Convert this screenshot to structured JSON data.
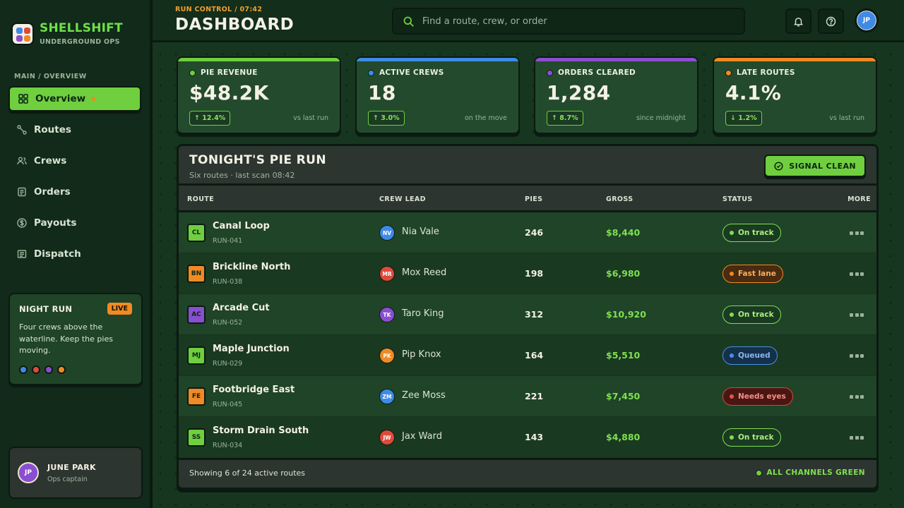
{
  "brand": {
    "name": "SHELLSHIFT",
    "subtitle": "UNDERGROUND OPS"
  },
  "sidebar": {
    "section_label": "MAIN / OVERVIEW",
    "items": [
      {
        "label": "Overview",
        "icon": "grid-icon",
        "active": true
      },
      {
        "label": "Routes",
        "icon": "route-icon"
      },
      {
        "label": "Crews",
        "icon": "users-icon"
      },
      {
        "label": "Orders",
        "icon": "clipboard-icon"
      },
      {
        "label": "Payouts",
        "icon": "dollar-icon"
      },
      {
        "label": "Dispatch",
        "icon": "list-icon"
      }
    ],
    "night_run": {
      "title": "NIGHT RUN",
      "badge": "LIVE",
      "text": "Four crews above the waterline. Keep the pies moving.",
      "dots": [
        "#3f8ae6",
        "#e04a3b",
        "#8a4fd0",
        "#f08a24"
      ]
    },
    "user": {
      "initials": "JP",
      "name": "JUNE PARK",
      "role": "Ops captain"
    }
  },
  "header": {
    "breadcrumb": "RUN CONTROL / 07:42",
    "title": "DASHBOARD",
    "search_placeholder": "Find a route, crew, or order",
    "avatar_initials": "JP"
  },
  "kpis": [
    {
      "label": "PIE REVENUE",
      "value": "$48.2K",
      "delta": "↑ 12.4%",
      "note": "vs last run",
      "color": "#6fcf3f"
    },
    {
      "label": "ACTIVE CREWS",
      "value": "18",
      "delta": "↑ 3.0%",
      "note": "on the move",
      "color": "#3f8ae6"
    },
    {
      "label": "ORDERS CLEARED",
      "value": "1,284",
      "delta": "↑ 8.7%",
      "note": "since midnight",
      "color": "#8a4fd0"
    },
    {
      "label": "LATE ROUTES",
      "value": "4.1%",
      "delta": "↓ 1.2%",
      "note": "vs last run",
      "color": "#f08a24"
    }
  ],
  "table": {
    "title": "TONIGHT'S PIE RUN",
    "subtitle": "Six routes · last scan 08:42",
    "action_label": "SIGNAL CLEAN",
    "columns": [
      "ROUTE",
      "CREW LEAD",
      "PIES",
      "GROSS",
      "STATUS",
      "MORE"
    ],
    "rows": [
      {
        "code": "CL",
        "code_color": "#6fcf3f",
        "route": "Canal Loop",
        "id": "RUN-041",
        "crew_initials": "NV",
        "crew_color": "#3f8ae6",
        "crew": "Nia Vale",
        "pies": "246",
        "gross": "$8,440",
        "status": "On track",
        "status_tone": "green"
      },
      {
        "code": "BN",
        "code_color": "#f08a24",
        "route": "Brickline North",
        "id": "RUN-038",
        "crew_initials": "MR",
        "crew_color": "#e04a3b",
        "crew": "Mox Reed",
        "pies": "198",
        "gross": "$6,980",
        "status": "Fast lane",
        "status_tone": "orange"
      },
      {
        "code": "AC",
        "code_color": "#8a4fd0",
        "route": "Arcade Cut",
        "id": "RUN-052",
        "crew_initials": "TK",
        "crew_color": "#8a4fd0",
        "crew": "Taro King",
        "pies": "312",
        "gross": "$10,920",
        "status": "On track",
        "status_tone": "green"
      },
      {
        "code": "MJ",
        "code_color": "#6fcf3f",
        "route": "Maple Junction",
        "id": "RUN-029",
        "crew_initials": "PK",
        "crew_color": "#f08a24",
        "crew": "Pip Knox",
        "pies": "164",
        "gross": "$5,510",
        "status": "Queued",
        "status_tone": "blue"
      },
      {
        "code": "FE",
        "code_color": "#f08a24",
        "route": "Footbridge East",
        "id": "RUN-045",
        "crew_initials": "ZM",
        "crew_color": "#3f8ae6",
        "crew": "Zee Moss",
        "pies": "221",
        "gross": "$7,450",
        "status": "Needs eyes",
        "status_tone": "red"
      },
      {
        "code": "SS",
        "code_color": "#6fcf3f",
        "route": "Storm Drain South",
        "id": "RUN-034",
        "crew_initials": "JW",
        "crew_color": "#e04a3b",
        "crew": "Jax Ward",
        "pies": "143",
        "gross": "$4,880",
        "status": "On track",
        "status_tone": "green"
      }
    ],
    "footer_left": "Showing 6 of 24 active routes",
    "footer_right": "ALL CHANNELS GREEN"
  }
}
